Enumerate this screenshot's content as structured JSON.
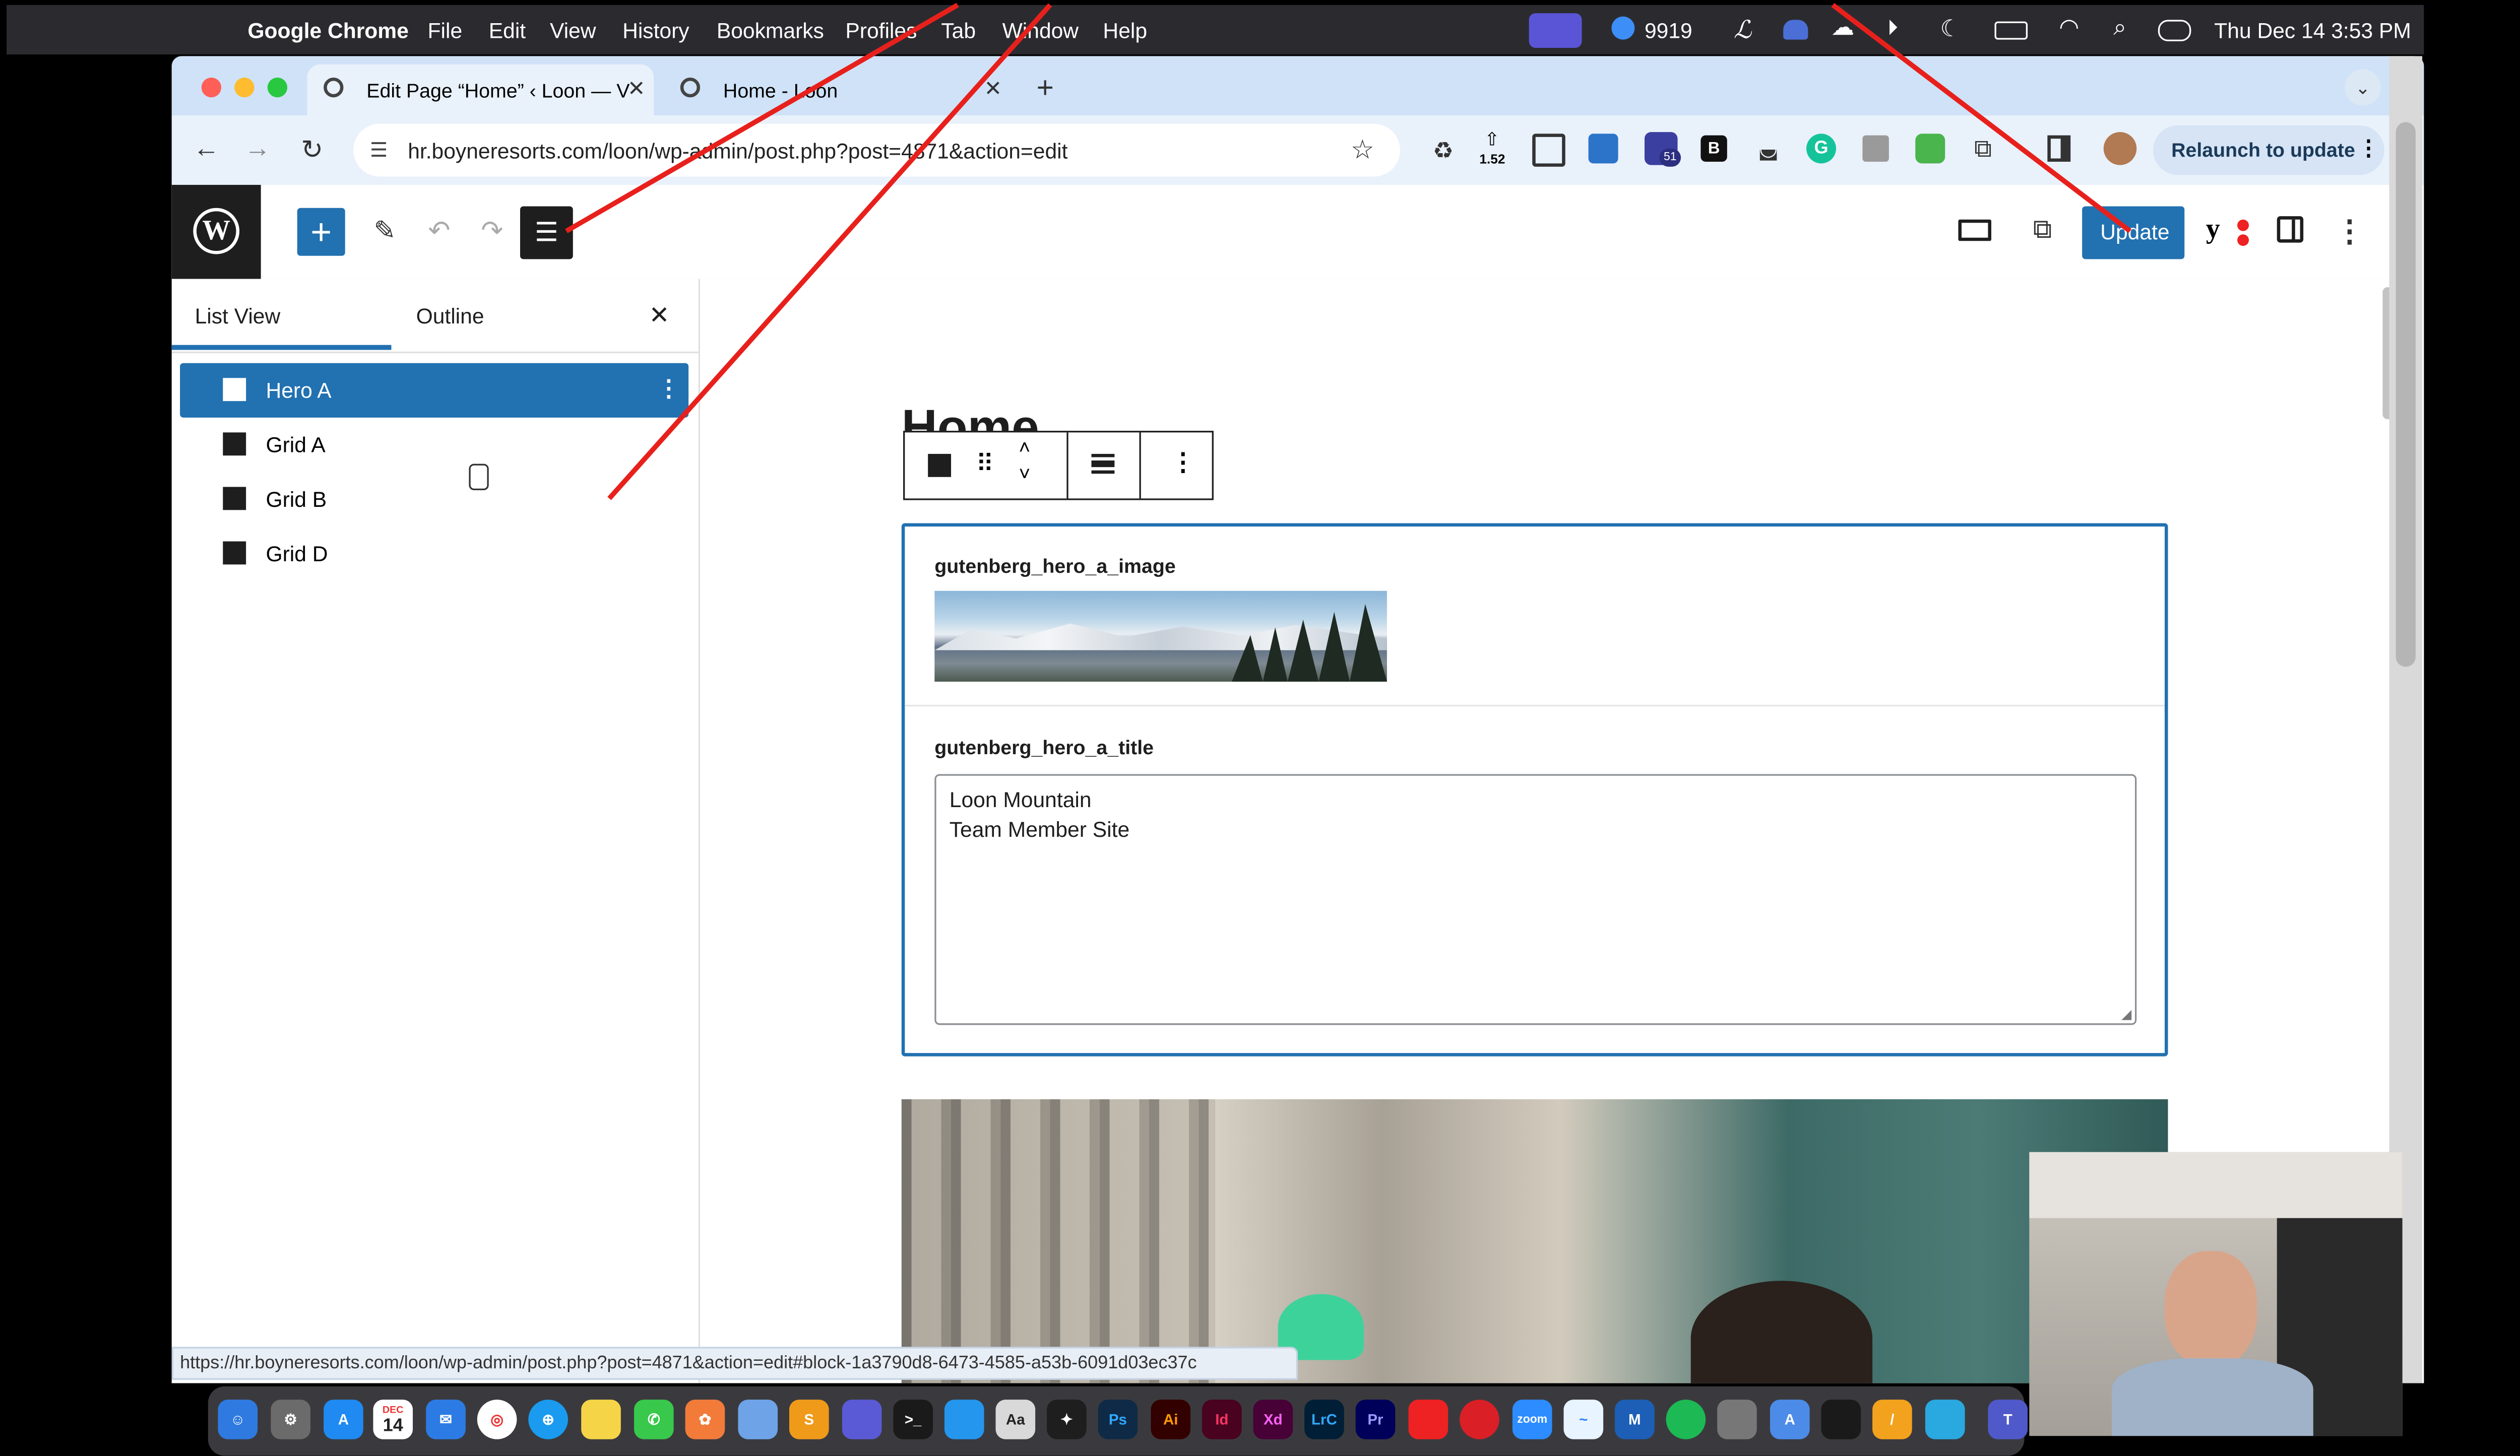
{
  "menubar": {
    "app_name": "Google Chrome",
    "items": [
      "File",
      "Edit",
      "View",
      "History",
      "Bookmarks",
      "Profiles",
      "Tab",
      "Window",
      "Help"
    ],
    "status_count": "9919",
    "datetime": "Thu Dec 14  3:53 PM"
  },
  "browser": {
    "tabs": [
      {
        "title": "Edit Page “Home” ‹ Loon — V"
      },
      {
        "title": "Home - Loon"
      }
    ],
    "url": "hr.boyneresorts.com/loon/wp-admin/post.php?post=4871&action=edit",
    "extension_badge": "1.52",
    "extension_count": "51",
    "relaunch_label": "Relaunch to update",
    "status_url": "https://hr.boyneresorts.com/loon/wp-admin/post.php?post=4871&action=edit#block-1a3790d8-6473-4585-a53b-6091d03ec37c"
  },
  "wp": {
    "update_label": "Update",
    "sidebar": {
      "tabs": [
        "List View",
        "Outline"
      ],
      "items": [
        {
          "label": "Hero A",
          "selected": true
        },
        {
          "label": "Grid A",
          "selected": false
        },
        {
          "label": "Grid B",
          "selected": false
        },
        {
          "label": "Grid D",
          "selected": false
        }
      ]
    },
    "page_title": "Home",
    "fields": {
      "image_label": "gutenberg_hero_a_image",
      "title_label": "gutenberg_hero_a_title",
      "title_line1": "Loon Mountain",
      "title_line2": "Team Member Site"
    }
  },
  "dock": {
    "calendar_month": "DEC",
    "calendar_day": "14",
    "apps": [
      "Ps",
      "Ai",
      "Id",
      "Xd",
      "LrC",
      "Pr"
    ]
  },
  "colors": {
    "accent": "#2271b1",
    "annotation": "#e8201c",
    "menubar_bg": "#2b2b2f",
    "tabstrip_bg": "#cfe2f7"
  }
}
